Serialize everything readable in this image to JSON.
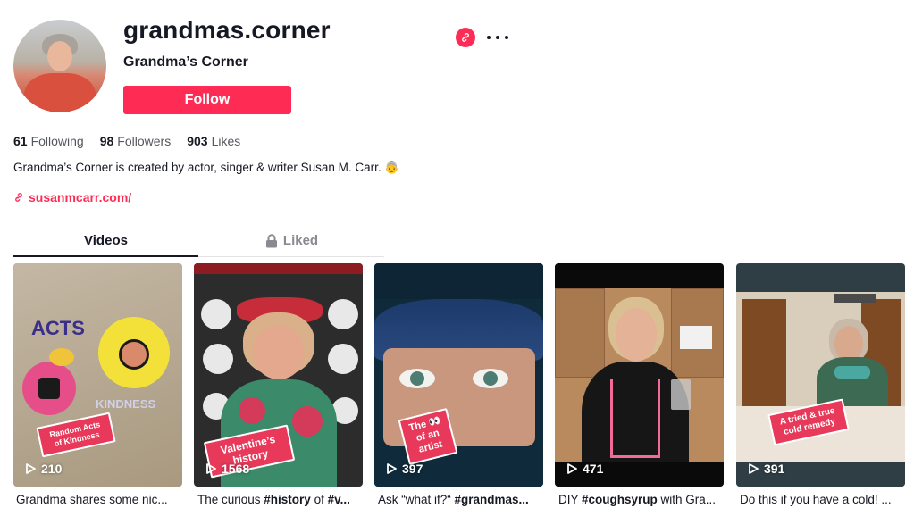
{
  "profile": {
    "username": "grandmas.corner",
    "nickname": "Grandma’s Corner",
    "follow_label": "Follow",
    "stats": {
      "following_count": "61",
      "following_label": "Following",
      "followers_count": "98",
      "followers_label": "Followers",
      "likes_count": "903",
      "likes_label": "Likes"
    },
    "bio": "Grandma’s Corner is created by actor, singer & writer Susan M. Carr. 👵",
    "link": "susanmcarr.com/"
  },
  "tabs": {
    "videos": "Videos",
    "liked": "Liked"
  },
  "videos": [
    {
      "views": "210",
      "sticker": "Random Acts of Kindness",
      "caption": "Grandma shares some nic..."
    },
    {
      "views": "1568",
      "sticker": "Valentine’s history",
      "caption_pre": "The curious ",
      "caption_tag1": "#history",
      "caption_mid": " of ",
      "caption_tag2": "#v..."
    },
    {
      "views": "397",
      "sticker": "The 👀 of an artist",
      "caption_pre": "Ask “what if?“ ",
      "caption_tag1": "#grandmas..."
    },
    {
      "views": "471",
      "sticker": "",
      "caption_pre": "DIY ",
      "caption_tag1": "#coughsyrup",
      "caption_mid": " with Gra..."
    },
    {
      "views": "391",
      "sticker": "A tried & true cold remedy",
      "caption": "Do this if you have a cold! ..."
    }
  ],
  "colors": {
    "brand": "#fe2c55",
    "text": "#161823",
    "muted": "#8a8b91"
  },
  "icons": {
    "share": "link-icon",
    "more": "more-icon",
    "lock": "lock-icon",
    "play": "play-icon"
  }
}
